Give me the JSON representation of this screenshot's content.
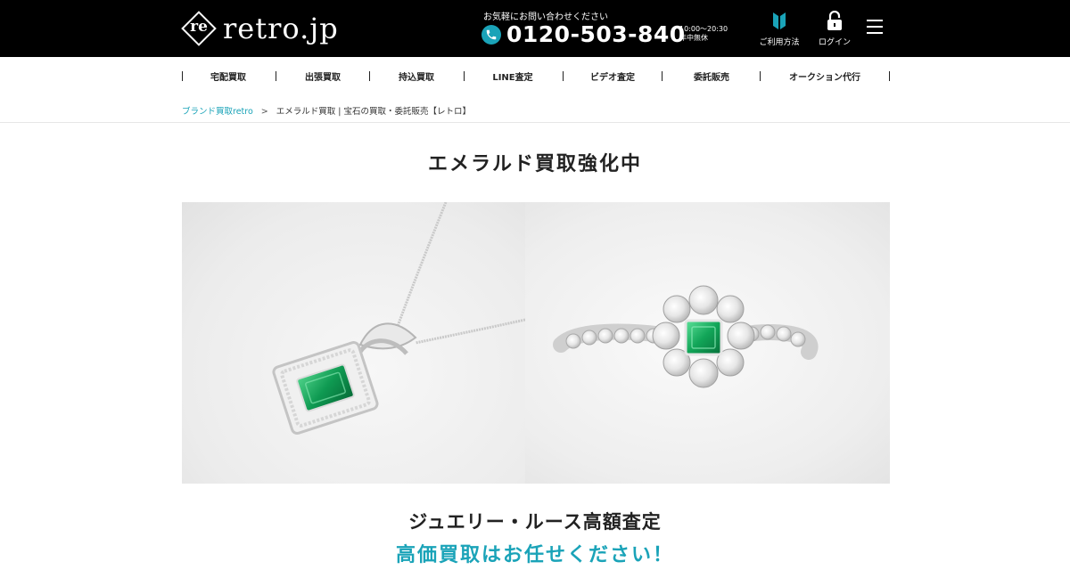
{
  "header": {
    "logo_mark": "re",
    "logo_text": "retro.jp",
    "contact_caption": "お気軽にお問い合わせください",
    "phone_number": "0120-503-840",
    "hours_line1": "10:00〜20:30",
    "hours_line2": "年中無休",
    "guide_label": "ご利用方法",
    "login_label": "ログイン",
    "icons": {
      "phone": "phone-icon",
      "guide": "book-icon",
      "login": "lock-icon",
      "menu": "hamburger-menu-icon"
    }
  },
  "nav": {
    "items": [
      {
        "label": "宅配買取"
      },
      {
        "label": "出張買取"
      },
      {
        "label": "持込買取"
      },
      {
        "label": "LINE査定"
      },
      {
        "label": "ビデオ査定"
      },
      {
        "label": "委託販売"
      },
      {
        "label": "オークション代行"
      }
    ]
  },
  "breadcrumb": {
    "home": "ブランド買取retro",
    "separator": ">",
    "current": "エメラルド買取 | 宝石の買取・委託販売【レトロ】"
  },
  "main": {
    "title": "エメラルド買取強化中",
    "sub_heading": "ジュエリー・ルース高額査定",
    "sub_heading_accent": "高価買取はお任せください！"
  },
  "colors": {
    "accent": "#1aa3b8",
    "header_bg": "#000000",
    "emerald": "#19a35a"
  }
}
